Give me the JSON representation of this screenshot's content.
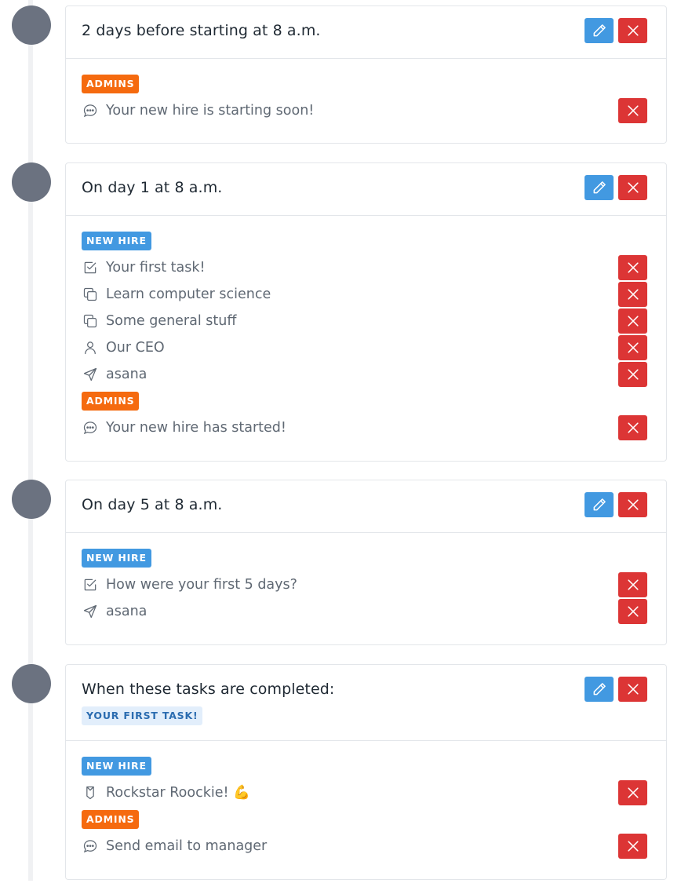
{
  "sequence": [
    {
      "title": "2 days before starting at 8 a.m.",
      "tag": null,
      "groups": [
        {
          "badge": "ADMINS",
          "items": [
            {
              "icon": "chat-bubble-icon",
              "label": "Your new hire is starting soon!"
            }
          ]
        }
      ]
    },
    {
      "title": "On day 1 at 8 a.m.",
      "tag": null,
      "groups": [
        {
          "badge": "NEW HIRE",
          "items": [
            {
              "icon": "checkbox-icon",
              "label": "Your first task!"
            },
            {
              "icon": "copy-pages-icon",
              "label": "Learn computer science"
            },
            {
              "icon": "copy-pages-icon",
              "label": "Some general stuff"
            },
            {
              "icon": "user-icon",
              "label": "Our CEO"
            },
            {
              "icon": "send-arrow-icon",
              "label": "asana"
            }
          ]
        },
        {
          "badge": "ADMINS",
          "items": [
            {
              "icon": "chat-bubble-icon",
              "label": "Your new hire has started!"
            }
          ]
        }
      ]
    },
    {
      "title": "On day 5 at 8 a.m.",
      "tag": null,
      "groups": [
        {
          "badge": "NEW HIRE",
          "items": [
            {
              "icon": "checkbox-icon",
              "label": "How were your first 5 days?"
            },
            {
              "icon": "send-arrow-icon",
              "label": "asana"
            }
          ]
        }
      ]
    },
    {
      "title": "When these tasks are completed:",
      "tag": "YOUR FIRST TASK!",
      "groups": [
        {
          "badge": "NEW HIRE",
          "items": [
            {
              "icon": "badge-shield-icon",
              "label": "Rockstar Roockie! 💪"
            }
          ]
        },
        {
          "badge": "ADMINS",
          "items": [
            {
              "icon": "chat-bubble-icon",
              "label": "Send email to manager"
            }
          ]
        }
      ]
    }
  ],
  "colors": {
    "edit_button": "#4299e1",
    "delete_button": "#dc3535",
    "admins_badge": "#f56a0f",
    "new_hire_badge": "#4299e1",
    "timeline_dot": "#6b7280"
  }
}
